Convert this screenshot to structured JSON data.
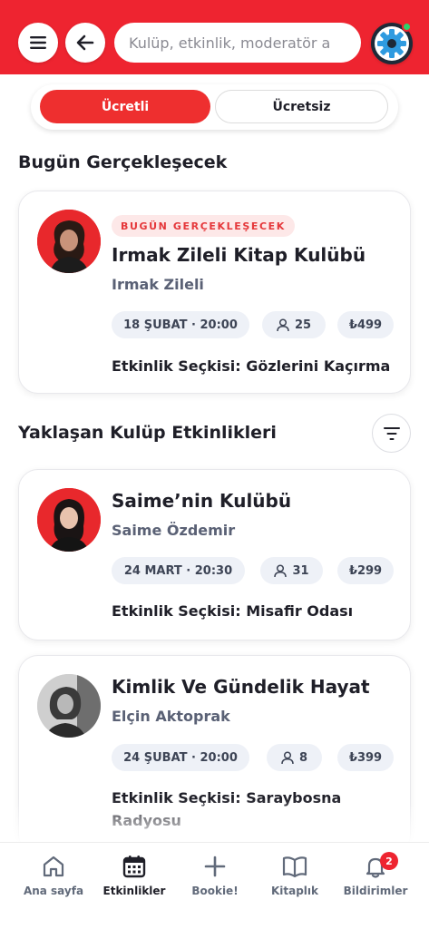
{
  "header": {
    "search_placeholder": "Kulüp, etkinlik, moderatör a"
  },
  "tabs": {
    "paid": "Ücretli",
    "free": "Ücretsiz",
    "active": "paid"
  },
  "sections": {
    "today": "Bugün Gerçekleşecek",
    "upcoming": "Yaklaşan Kulüp Etkinlikleri"
  },
  "events": [
    {
      "badge": "BUGÜN GERÇEKLEŞECEK",
      "title": "Irmak Zileli Kitap Kulübü",
      "moderator": "Irmak Zileli",
      "date": "18 ŞUBAT · 20:00",
      "attendees": "25",
      "price": "₺499",
      "selection": "Etkinlik Seçkisi: Gözlerini Kaçırma"
    },
    {
      "title": "Saime’nin Kulübü",
      "moderator": "Saime Özdemir",
      "date": "24 MART · 20:30",
      "attendees": "31",
      "price": "₺299",
      "selection": "Etkinlik Seçkisi: Misafir Odası"
    },
    {
      "title": "Kimlik Ve Gündelik Hayat",
      "moderator": "Elçin Aktoprak",
      "date": "24 ŞUBAT · 20:00",
      "attendees": "8",
      "price": "₺399",
      "selection": "Etkinlik Seçkisi: Saraybosna Radyosu"
    }
  ],
  "nav": {
    "home": "Ana sayfa",
    "events": "Etkinlikler",
    "bookie": "Bookie!",
    "library": "Kitaplık",
    "notifications": "Bildirimler",
    "notifications_count": "2",
    "active": "events"
  },
  "colors": {
    "brand_red": "#ee2430",
    "online_green": "#2bd36b",
    "pill_bg": "#eef1f7"
  },
  "icons": [
    "menu-icon",
    "back-arrow-icon",
    "gear-icon",
    "filter-icon",
    "user-icon",
    "home-icon",
    "calendar-icon",
    "plus-icon",
    "book-icon",
    "bell-icon"
  ]
}
